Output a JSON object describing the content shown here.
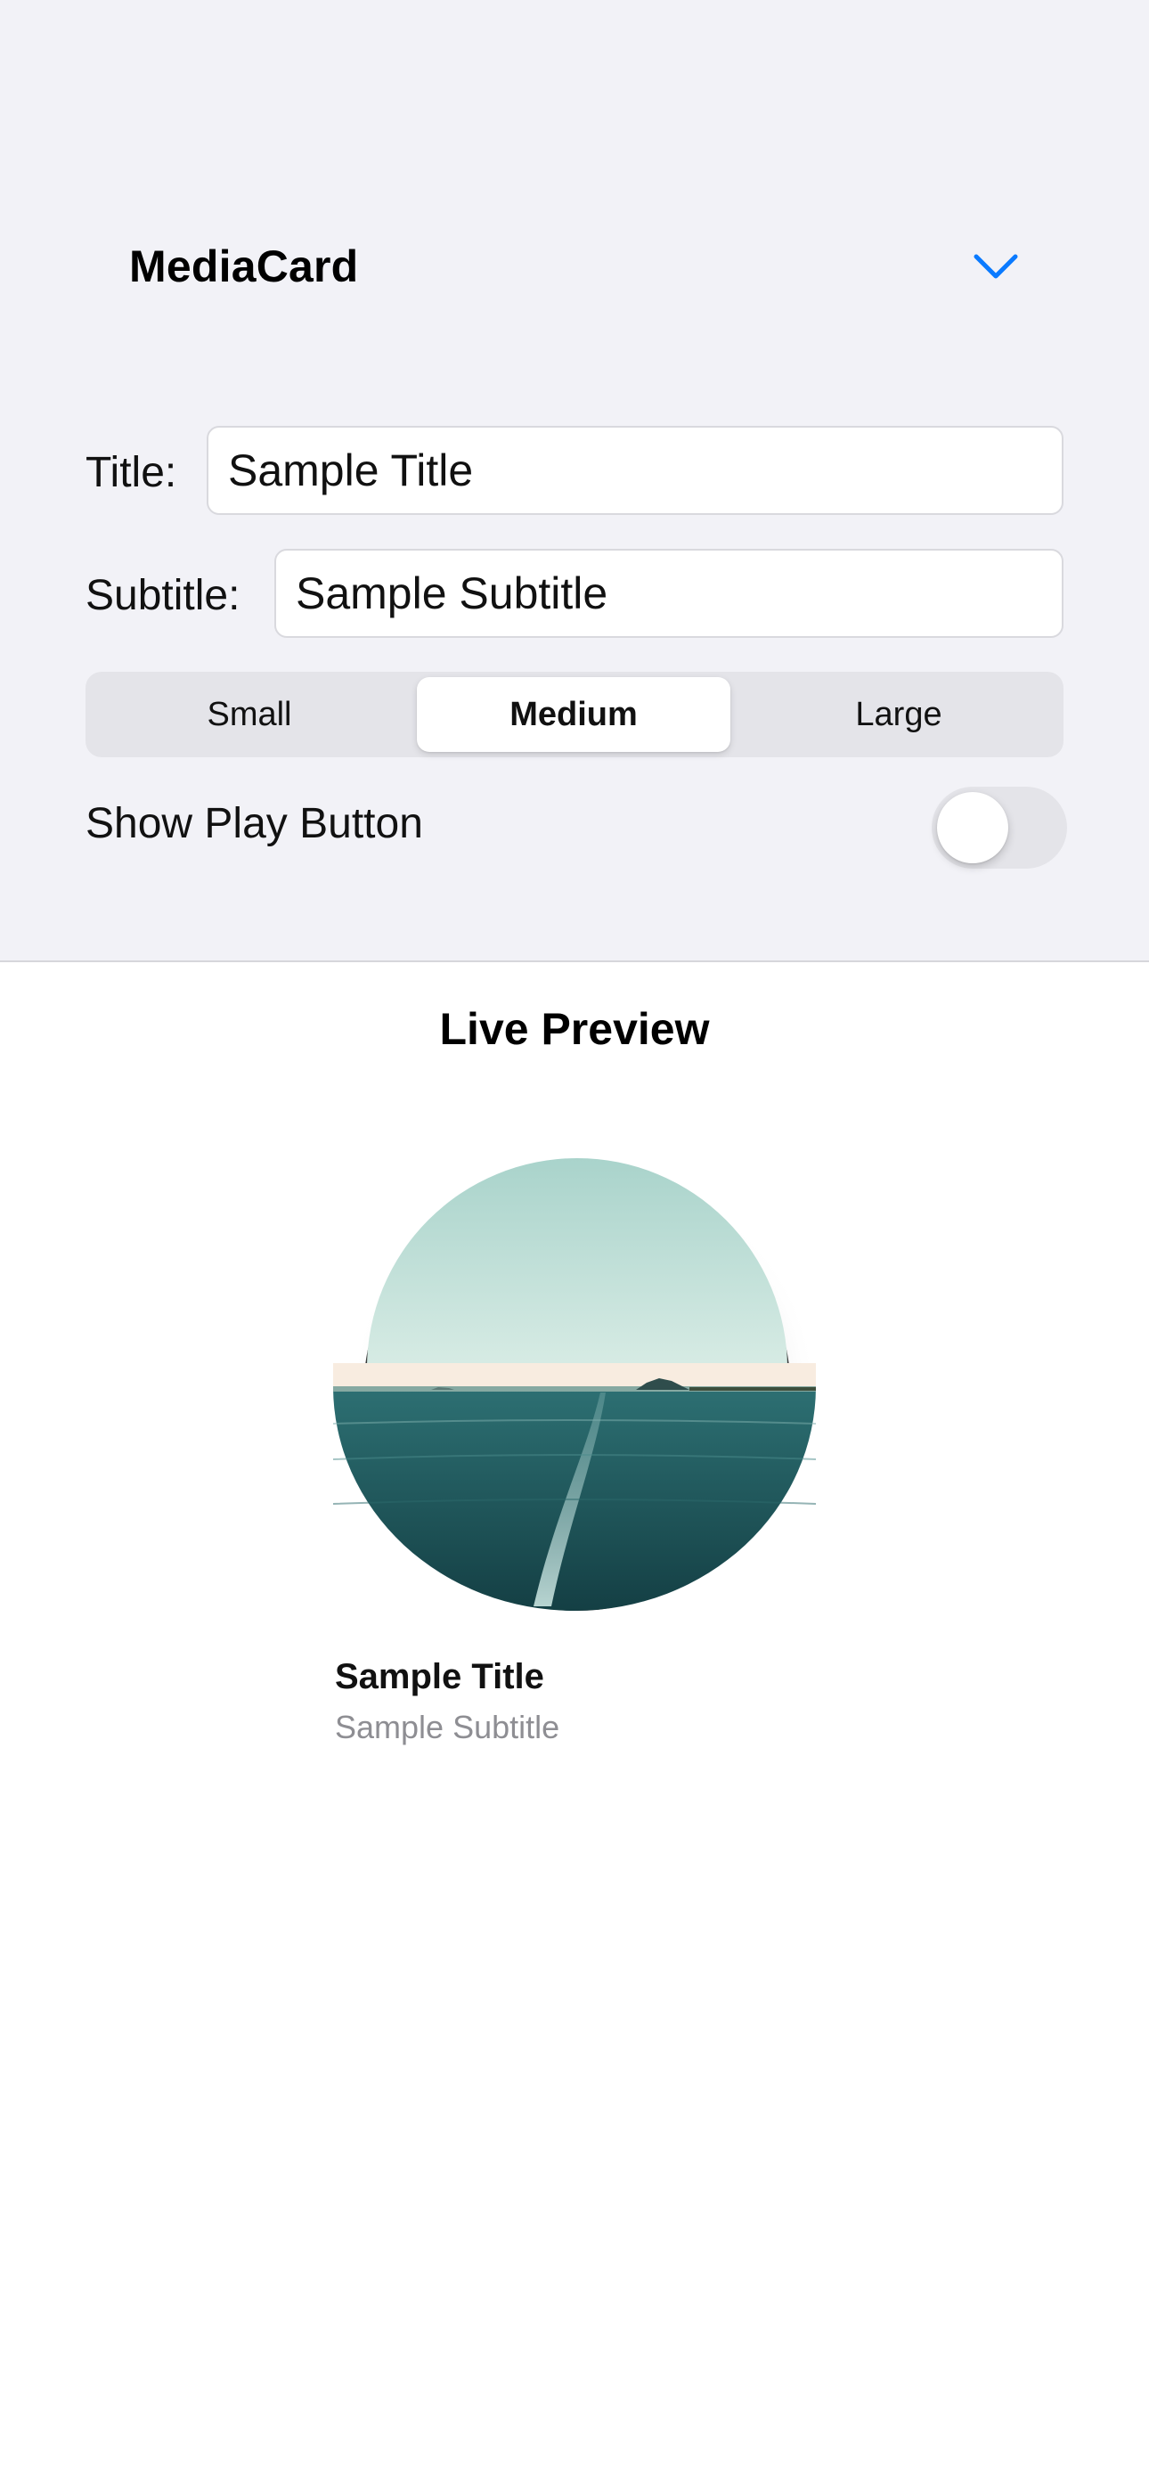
{
  "header": {
    "title": "MediaCard"
  },
  "form": {
    "title_label": "Title:",
    "title_value": "Sample Title",
    "subtitle_label": "Subtitle:",
    "subtitle_value": "Sample Subtitle",
    "size_segments": [
      "Small",
      "Medium",
      "Large"
    ],
    "selected_size": "Medium",
    "play_button_label": "Show Play Button",
    "play_button_on": false
  },
  "preview": {
    "heading": "Live Preview",
    "card_title": "Sample Title",
    "card_subtitle": "Sample Subtitle"
  },
  "colors": {
    "accent": "#0a7aff",
    "panel_background": "#f2f2f7",
    "secondary_text": "#8e8e93"
  }
}
